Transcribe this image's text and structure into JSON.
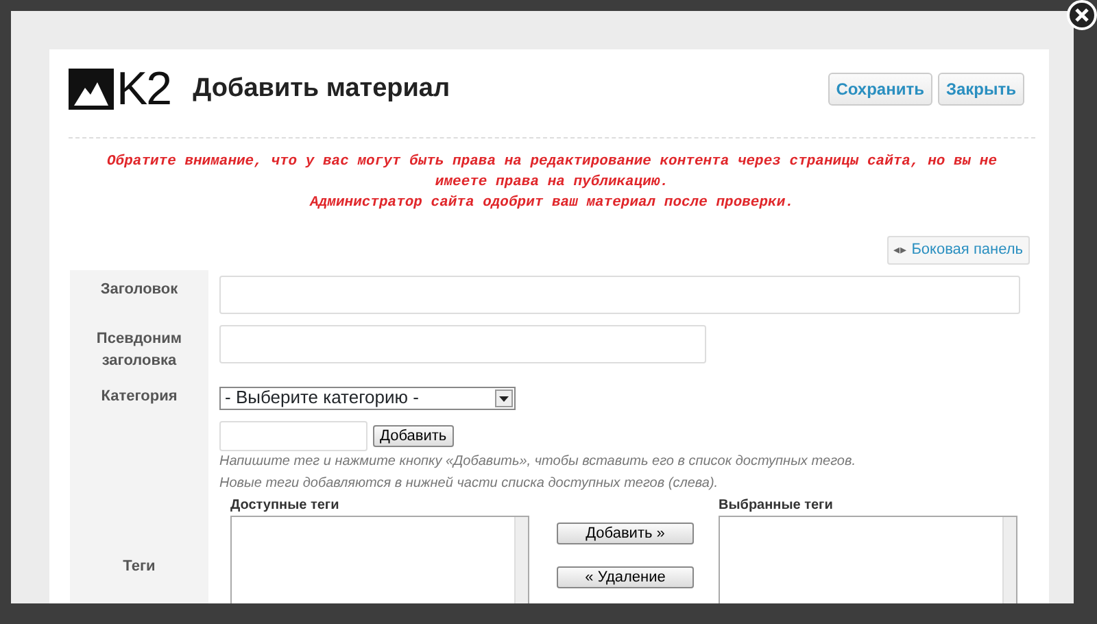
{
  "header": {
    "logo": "K2",
    "title": "Добавить материал",
    "buttons": [
      "Сохранить",
      "Закрыть"
    ]
  },
  "notice": [
    "Обратите внимание, что у вас могут быть права на редактирование контента через страницы сайта, но вы не имеете права на публикацию.",
    "Администратор сайта одобрит ваш материал после проверки."
  ],
  "sidebar_toggle": {
    "icon": "◂▸",
    "label": "Боковая панель"
  },
  "fields": [
    {
      "kind": "text",
      "label": "Заголовок"
    },
    {
      "kind": "short_text",
      "label": "Псевдоним заголовка"
    },
    {
      "kind": "select",
      "label": "Категория",
      "value": "- Выберите категорию -"
    }
  ],
  "tags": {
    "label": "Теги",
    "add_button": "Добавить",
    "hints": [
      "Напишите тег и нажмите кнопку «Добавить», чтобы вставить его в список доступных тегов.",
      "Новые теги добавляются в нижней части списка доступных тегов (слева)."
    ],
    "available_title": "Доступные теги",
    "selected_title": "Выбранные теги",
    "move_buttons": [
      "Добавить »",
      "« Удаление"
    ]
  }
}
